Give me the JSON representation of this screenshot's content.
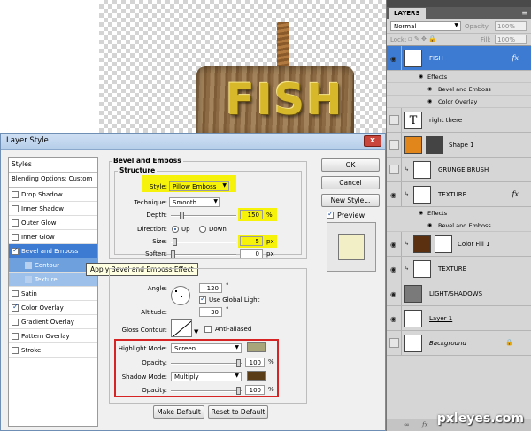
{
  "canvas": {
    "sign_text": "FISH"
  },
  "dialog": {
    "title": "Layer Style",
    "close": "x",
    "styles_header": "Styles",
    "blending_header": "Blending Options: Custom",
    "style_items": [
      {
        "label": "Drop Shadow",
        "checked": false
      },
      {
        "label": "Inner Shadow",
        "checked": false
      },
      {
        "label": "Outer Glow",
        "checked": false
      },
      {
        "label": "Inner Glow",
        "checked": false
      },
      {
        "label": "Bevel and Emboss",
        "checked": true
      },
      {
        "label": "Contour",
        "checked": false
      },
      {
        "label": "Texture",
        "checked": false
      },
      {
        "label": "Satin",
        "checked": false
      },
      {
        "label": "Color Overlay",
        "checked": true
      },
      {
        "label": "Gradient Overlay",
        "checked": false
      },
      {
        "label": "Pattern Overlay",
        "checked": false
      },
      {
        "label": "Stroke",
        "checked": false
      }
    ],
    "tooltip": "Apply Bevel and Emboss Effect",
    "bevel": {
      "section_title": "Bevel and Emboss",
      "structure_title": "Structure",
      "style_label": "Style:",
      "style_value": "Pillow Emboss",
      "technique_label": "Technique:",
      "technique_value": "Smooth",
      "depth_label": "Depth:",
      "depth_value": "150",
      "depth_unit": "%",
      "direction_label": "Direction:",
      "dir_up": "Up",
      "dir_down": "Down",
      "size_label": "Size:",
      "size_value": "5",
      "size_unit": "px",
      "soften_label": "Soften:",
      "soften_value": "0",
      "soften_unit": "px"
    },
    "shading": {
      "angle_label": "Angle:",
      "angle_value": "120",
      "deg": "°",
      "global_light": "Use Global Light",
      "altitude_label": "Altitude:",
      "altitude_value": "30",
      "gloss_label": "Gloss Contour:",
      "anti_aliased": "Anti-aliased",
      "highlight_label": "Highlight Mode:",
      "highlight_value": "Screen",
      "highlight_color": "#a9a57a",
      "opacity_label": "Opacity:",
      "highlight_opacity": "100",
      "shadow_label": "Shadow Mode:",
      "shadow_value": "Multiply",
      "shadow_color": "#5a3d16",
      "shadow_opacity": "100",
      "pct": "%"
    },
    "make_default": "Make Default",
    "reset_default": "Reset to Default",
    "ok": "OK",
    "cancel": "Cancel",
    "new_style": "New Style...",
    "preview": "Preview"
  },
  "layers_panel": {
    "tab": "LAYERS",
    "blend_mode": "Normal",
    "opacity_label": "Opacity:",
    "opacity_value": "100%",
    "lock_label": "Lock:",
    "fill_label": "Fill:",
    "fill_value": "100%",
    "effects_label": "Effects",
    "layers": [
      {
        "name": "FISH",
        "type": "text",
        "selected": true,
        "visible": true,
        "fx": true,
        "effects": [
          "Bevel and Emboss",
          "Color Overlay"
        ]
      },
      {
        "name": "right there",
        "type": "text",
        "selected": false,
        "visible": false,
        "fx": false,
        "effects": []
      },
      {
        "name": "Shape 1",
        "type": "shape",
        "selected": false,
        "visible": false,
        "fx": false,
        "effects": []
      },
      {
        "name": "GRUNGE BRUSH",
        "type": "pixel",
        "selected": false,
        "visible": false,
        "fx": false,
        "effects": []
      },
      {
        "name": "TEXTURE",
        "type": "pixel",
        "selected": false,
        "visible": true,
        "fx": true,
        "effects": [
          "Bevel and Emboss"
        ]
      },
      {
        "name": "Color Fill 1",
        "type": "fill",
        "selected": false,
        "visible": true,
        "fx": false,
        "effects": []
      },
      {
        "name": "TEXTURE",
        "type": "pixel",
        "selected": false,
        "visible": true,
        "fx": false,
        "effects": []
      },
      {
        "name": "LIGHT/SHADOWS",
        "type": "group",
        "selected": false,
        "visible": true,
        "fx": false,
        "effects": []
      },
      {
        "name": "Layer 1",
        "type": "pixel",
        "selected": false,
        "visible": true,
        "fx": false,
        "effects": []
      },
      {
        "name": "Background",
        "type": "background",
        "selected": false,
        "visible": false,
        "fx": false,
        "effects": []
      }
    ],
    "fx_label": "fx"
  },
  "watermark": "pxleyes.com"
}
